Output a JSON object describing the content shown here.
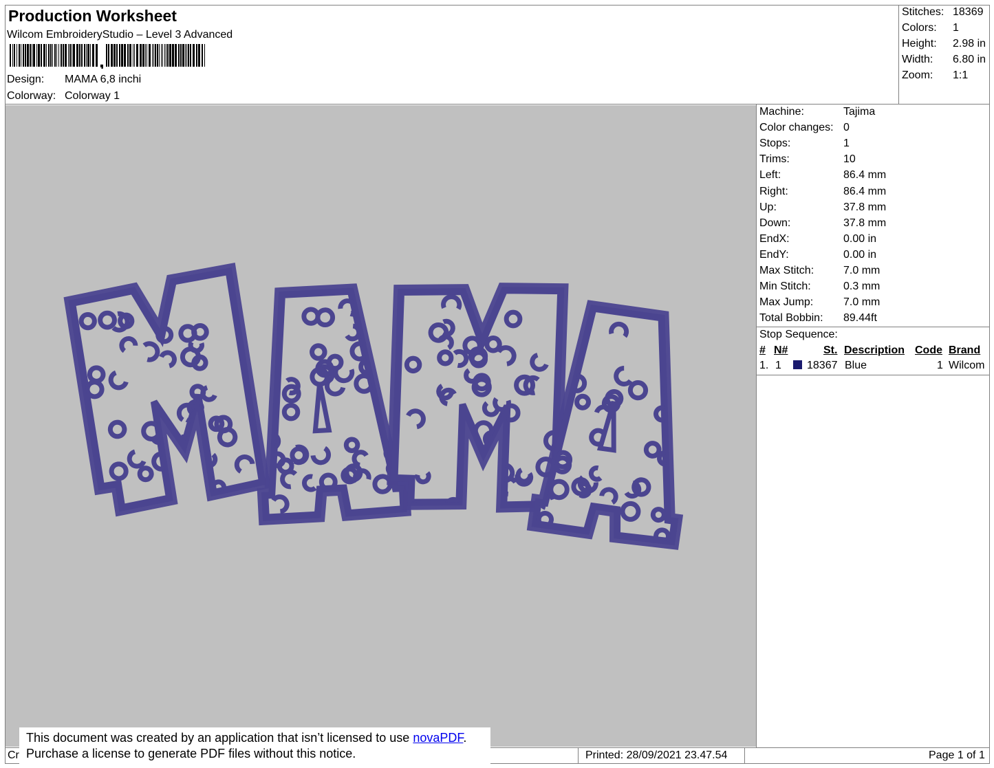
{
  "header": {
    "title": "Production Worksheet",
    "software": "Wilcom EmbroideryStudio – Level 3 Advanced",
    "design_label": "Design:",
    "design_value": "MAMA 6,8 inchi",
    "colorway_label": "Colorway:",
    "colorway_value": "Colorway 1"
  },
  "summary": [
    {
      "label": "Stitches:",
      "value": "18369"
    },
    {
      "label": "Colors:",
      "value": "1"
    },
    {
      "label": "Height:",
      "value": "2.98 in"
    },
    {
      "label": "Width:",
      "value": "6.80 in"
    },
    {
      "label": "Zoom:",
      "value": "1:1"
    }
  ],
  "details": [
    {
      "label": "Machine:",
      "value": "Tajima"
    },
    {
      "label": "Color changes:",
      "value": "0"
    },
    {
      "label": "Stops:",
      "value": "1"
    },
    {
      "label": "Trims:",
      "value": "10"
    },
    {
      "label": "Left:",
      "value": "86.4 mm"
    },
    {
      "label": "Right:",
      "value": "86.4 mm"
    },
    {
      "label": "Up:",
      "value": "37.8 mm"
    },
    {
      "label": "Down:",
      "value": "37.8 mm"
    },
    {
      "label": "EndX:",
      "value": "0.00 in"
    },
    {
      "label": "EndY:",
      "value": "0.00 in"
    },
    {
      "label": "Max Stitch:",
      "value": "7.0 mm"
    },
    {
      "label": "Min Stitch:",
      "value": "0.3 mm"
    },
    {
      "label": "Max Jump:",
      "value": "7.0 mm"
    },
    {
      "label": "Total Bobbin:",
      "value": "89.44ft"
    }
  ],
  "stop_sequence": {
    "heading": "Stop Sequence:",
    "columns": [
      "#",
      "N#",
      "St.",
      "Description",
      "Code",
      "Brand"
    ],
    "rows": [
      {
        "num": "1.",
        "n": "1",
        "stitches": "18367",
        "description": "Blue",
        "code": "1",
        "brand": "Wilcom",
        "color": "#1a1a6e"
      }
    ]
  },
  "design_preview": {
    "letters": "MAMA",
    "thread_color": "#4b4590",
    "background_color": "#c0c0c0"
  },
  "footer": {
    "left_fragment": "Cr",
    "notice_line1": "This document was created by an application that isn’t licensed to use ",
    "notice_link": "novaPDF",
    "notice_period": ".",
    "notice_line2": "Purchase a license to generate PDF files without this notice.",
    "printed": "Printed: 28/09/2021 23.47.54",
    "page": "Page 1 of 1"
  }
}
